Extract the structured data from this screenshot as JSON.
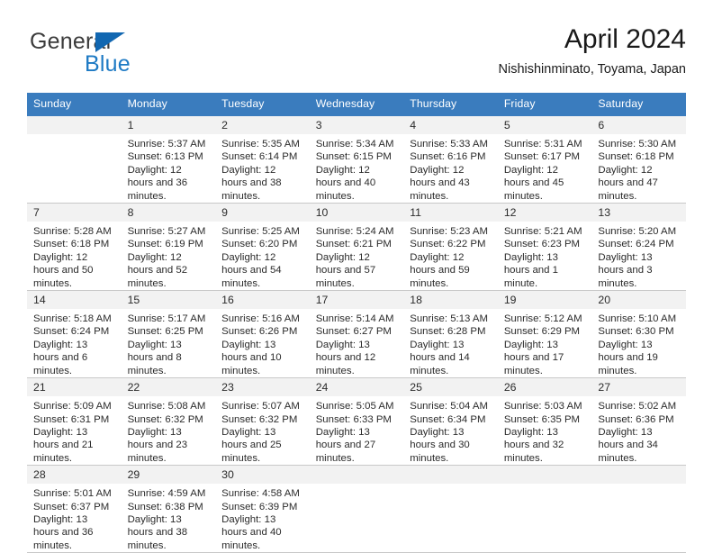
{
  "brand": {
    "name_part1": "General",
    "name_part2": "Blue",
    "triangle_icon": "blue-triangle-icon",
    "color_dark": "#3b3b3b",
    "color_blue": "#1e7ac4"
  },
  "header": {
    "title": "April 2024",
    "subtitle": "Nishishinminato, Toyama, Japan"
  },
  "calendar": {
    "accent_color": "#3a7cbe",
    "band_color": "#f2f2f2",
    "weekday_headers": [
      "Sunday",
      "Monday",
      "Tuesday",
      "Wednesday",
      "Thursday",
      "Friday",
      "Saturday"
    ],
    "weeks": [
      [
        {
          "day": "",
          "sunrise": "",
          "sunset": "",
          "daylight": ""
        },
        {
          "day": "1",
          "sunrise": "Sunrise: 5:37 AM",
          "sunset": "Sunset: 6:13 PM",
          "daylight": "Daylight: 12 hours and 36 minutes."
        },
        {
          "day": "2",
          "sunrise": "Sunrise: 5:35 AM",
          "sunset": "Sunset: 6:14 PM",
          "daylight": "Daylight: 12 hours and 38 minutes."
        },
        {
          "day": "3",
          "sunrise": "Sunrise: 5:34 AM",
          "sunset": "Sunset: 6:15 PM",
          "daylight": "Daylight: 12 hours and 40 minutes."
        },
        {
          "day": "4",
          "sunrise": "Sunrise: 5:33 AM",
          "sunset": "Sunset: 6:16 PM",
          "daylight": "Daylight: 12 hours and 43 minutes."
        },
        {
          "day": "5",
          "sunrise": "Sunrise: 5:31 AM",
          "sunset": "Sunset: 6:17 PM",
          "daylight": "Daylight: 12 hours and 45 minutes."
        },
        {
          "day": "6",
          "sunrise": "Sunrise: 5:30 AM",
          "sunset": "Sunset: 6:18 PM",
          "daylight": "Daylight: 12 hours and 47 minutes."
        }
      ],
      [
        {
          "day": "7",
          "sunrise": "Sunrise: 5:28 AM",
          "sunset": "Sunset: 6:18 PM",
          "daylight": "Daylight: 12 hours and 50 minutes."
        },
        {
          "day": "8",
          "sunrise": "Sunrise: 5:27 AM",
          "sunset": "Sunset: 6:19 PM",
          "daylight": "Daylight: 12 hours and 52 minutes."
        },
        {
          "day": "9",
          "sunrise": "Sunrise: 5:25 AM",
          "sunset": "Sunset: 6:20 PM",
          "daylight": "Daylight: 12 hours and 54 minutes."
        },
        {
          "day": "10",
          "sunrise": "Sunrise: 5:24 AM",
          "sunset": "Sunset: 6:21 PM",
          "daylight": "Daylight: 12 hours and 57 minutes."
        },
        {
          "day": "11",
          "sunrise": "Sunrise: 5:23 AM",
          "sunset": "Sunset: 6:22 PM",
          "daylight": "Daylight: 12 hours and 59 minutes."
        },
        {
          "day": "12",
          "sunrise": "Sunrise: 5:21 AM",
          "sunset": "Sunset: 6:23 PM",
          "daylight": "Daylight: 13 hours and 1 minute."
        },
        {
          "day": "13",
          "sunrise": "Sunrise: 5:20 AM",
          "sunset": "Sunset: 6:24 PM",
          "daylight": "Daylight: 13 hours and 3 minutes."
        }
      ],
      [
        {
          "day": "14",
          "sunrise": "Sunrise: 5:18 AM",
          "sunset": "Sunset: 6:24 PM",
          "daylight": "Daylight: 13 hours and 6 minutes."
        },
        {
          "day": "15",
          "sunrise": "Sunrise: 5:17 AM",
          "sunset": "Sunset: 6:25 PM",
          "daylight": "Daylight: 13 hours and 8 minutes."
        },
        {
          "day": "16",
          "sunrise": "Sunrise: 5:16 AM",
          "sunset": "Sunset: 6:26 PM",
          "daylight": "Daylight: 13 hours and 10 minutes."
        },
        {
          "day": "17",
          "sunrise": "Sunrise: 5:14 AM",
          "sunset": "Sunset: 6:27 PM",
          "daylight": "Daylight: 13 hours and 12 minutes."
        },
        {
          "day": "18",
          "sunrise": "Sunrise: 5:13 AM",
          "sunset": "Sunset: 6:28 PM",
          "daylight": "Daylight: 13 hours and 14 minutes."
        },
        {
          "day": "19",
          "sunrise": "Sunrise: 5:12 AM",
          "sunset": "Sunset: 6:29 PM",
          "daylight": "Daylight: 13 hours and 17 minutes."
        },
        {
          "day": "20",
          "sunrise": "Sunrise: 5:10 AM",
          "sunset": "Sunset: 6:30 PM",
          "daylight": "Daylight: 13 hours and 19 minutes."
        }
      ],
      [
        {
          "day": "21",
          "sunrise": "Sunrise: 5:09 AM",
          "sunset": "Sunset: 6:31 PM",
          "daylight": "Daylight: 13 hours and 21 minutes."
        },
        {
          "day": "22",
          "sunrise": "Sunrise: 5:08 AM",
          "sunset": "Sunset: 6:32 PM",
          "daylight": "Daylight: 13 hours and 23 minutes."
        },
        {
          "day": "23",
          "sunrise": "Sunrise: 5:07 AM",
          "sunset": "Sunset: 6:32 PM",
          "daylight": "Daylight: 13 hours and 25 minutes."
        },
        {
          "day": "24",
          "sunrise": "Sunrise: 5:05 AM",
          "sunset": "Sunset: 6:33 PM",
          "daylight": "Daylight: 13 hours and 27 minutes."
        },
        {
          "day": "25",
          "sunrise": "Sunrise: 5:04 AM",
          "sunset": "Sunset: 6:34 PM",
          "daylight": "Daylight: 13 hours and 30 minutes."
        },
        {
          "day": "26",
          "sunrise": "Sunrise: 5:03 AM",
          "sunset": "Sunset: 6:35 PM",
          "daylight": "Daylight: 13 hours and 32 minutes."
        },
        {
          "day": "27",
          "sunrise": "Sunrise: 5:02 AM",
          "sunset": "Sunset: 6:36 PM",
          "daylight": "Daylight: 13 hours and 34 minutes."
        }
      ],
      [
        {
          "day": "28",
          "sunrise": "Sunrise: 5:01 AM",
          "sunset": "Sunset: 6:37 PM",
          "daylight": "Daylight: 13 hours and 36 minutes."
        },
        {
          "day": "29",
          "sunrise": "Sunrise: 4:59 AM",
          "sunset": "Sunset: 6:38 PM",
          "daylight": "Daylight: 13 hours and 38 minutes."
        },
        {
          "day": "30",
          "sunrise": "Sunrise: 4:58 AM",
          "sunset": "Sunset: 6:39 PM",
          "daylight": "Daylight: 13 hours and 40 minutes."
        },
        {
          "day": "",
          "sunrise": "",
          "sunset": "",
          "daylight": ""
        },
        {
          "day": "",
          "sunrise": "",
          "sunset": "",
          "daylight": ""
        },
        {
          "day": "",
          "sunrise": "",
          "sunset": "",
          "daylight": ""
        },
        {
          "day": "",
          "sunrise": "",
          "sunset": "",
          "daylight": ""
        }
      ]
    ]
  }
}
